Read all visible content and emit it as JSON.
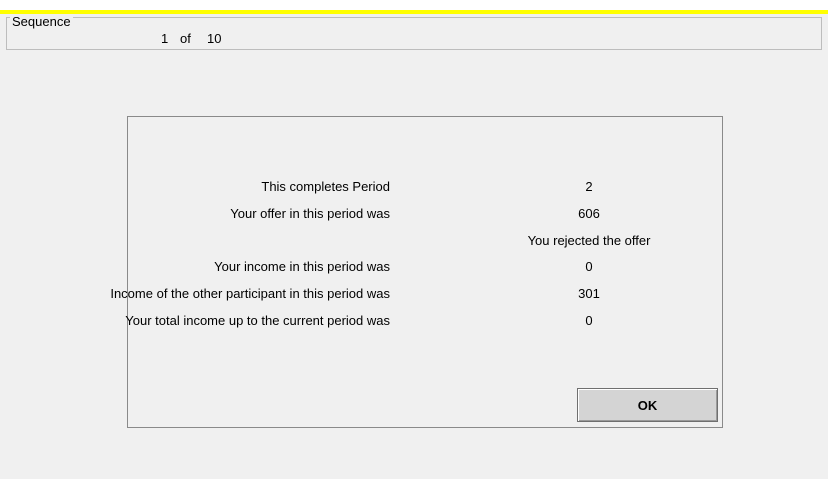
{
  "sequence": {
    "legend": "Sequence",
    "current": "1",
    "of_label": "of",
    "total": "10"
  },
  "result_dialog": {
    "rows": [
      {
        "label": "This completes Period",
        "value": "2"
      },
      {
        "label": "Your offer in this period was",
        "value": "606"
      },
      {
        "label": "",
        "value": "You rejected the offer"
      },
      {
        "label": "Your income in this period was",
        "value": "0"
      },
      {
        "label": "Income of the other participant in this period was",
        "value": "301"
      },
      {
        "label": "Your total income up to the current period was",
        "value": "0"
      }
    ],
    "ok_label": "OK"
  },
  "colors": {
    "accent_bar": "#ffff00",
    "background": "#f0f0f0",
    "button": "#d4d4d4"
  }
}
